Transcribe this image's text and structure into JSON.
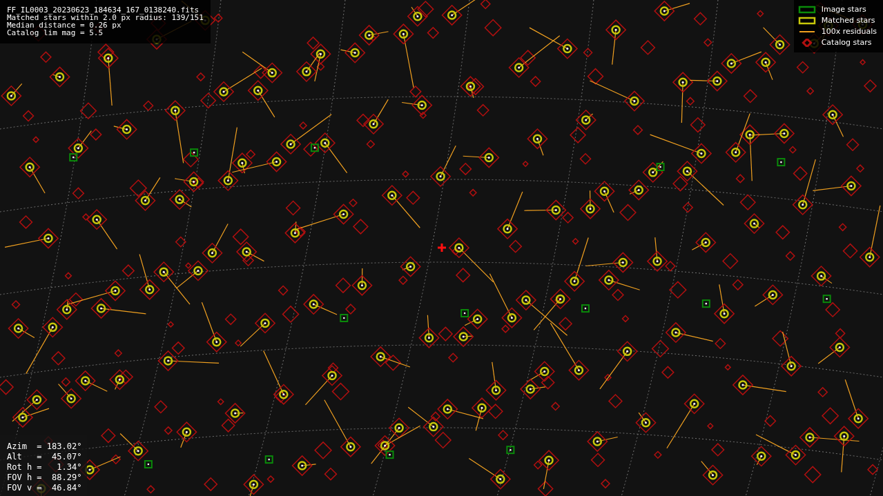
{
  "info": {
    "lines": [
      "FF_IL0003_20230623_184634_167_0138240.fits",
      "Matched stars within 2.0 px radius: 139/151",
      "Median distance = 0.26 px",
      "Catalog lim mag = 5.5"
    ]
  },
  "legend": [
    {
      "kind": "box",
      "color": "#0a8a0a",
      "label": "Image stars"
    },
    {
      "kind": "box",
      "color": "#c8c80a",
      "label": "Matched stars"
    },
    {
      "kind": "line",
      "color": "#f0a020",
      "label": "100x residuals"
    },
    {
      "kind": "diamond",
      "color": "#b01010",
      "label": "Catalog stars"
    }
  ],
  "pointing": {
    "lines": [
      "Azim  = 183.02°",
      "Alt   =  45.07°",
      "Rot h =   1.34°",
      "FOV h =  88.29°",
      "FOV v =  46.84°"
    ]
  }
}
